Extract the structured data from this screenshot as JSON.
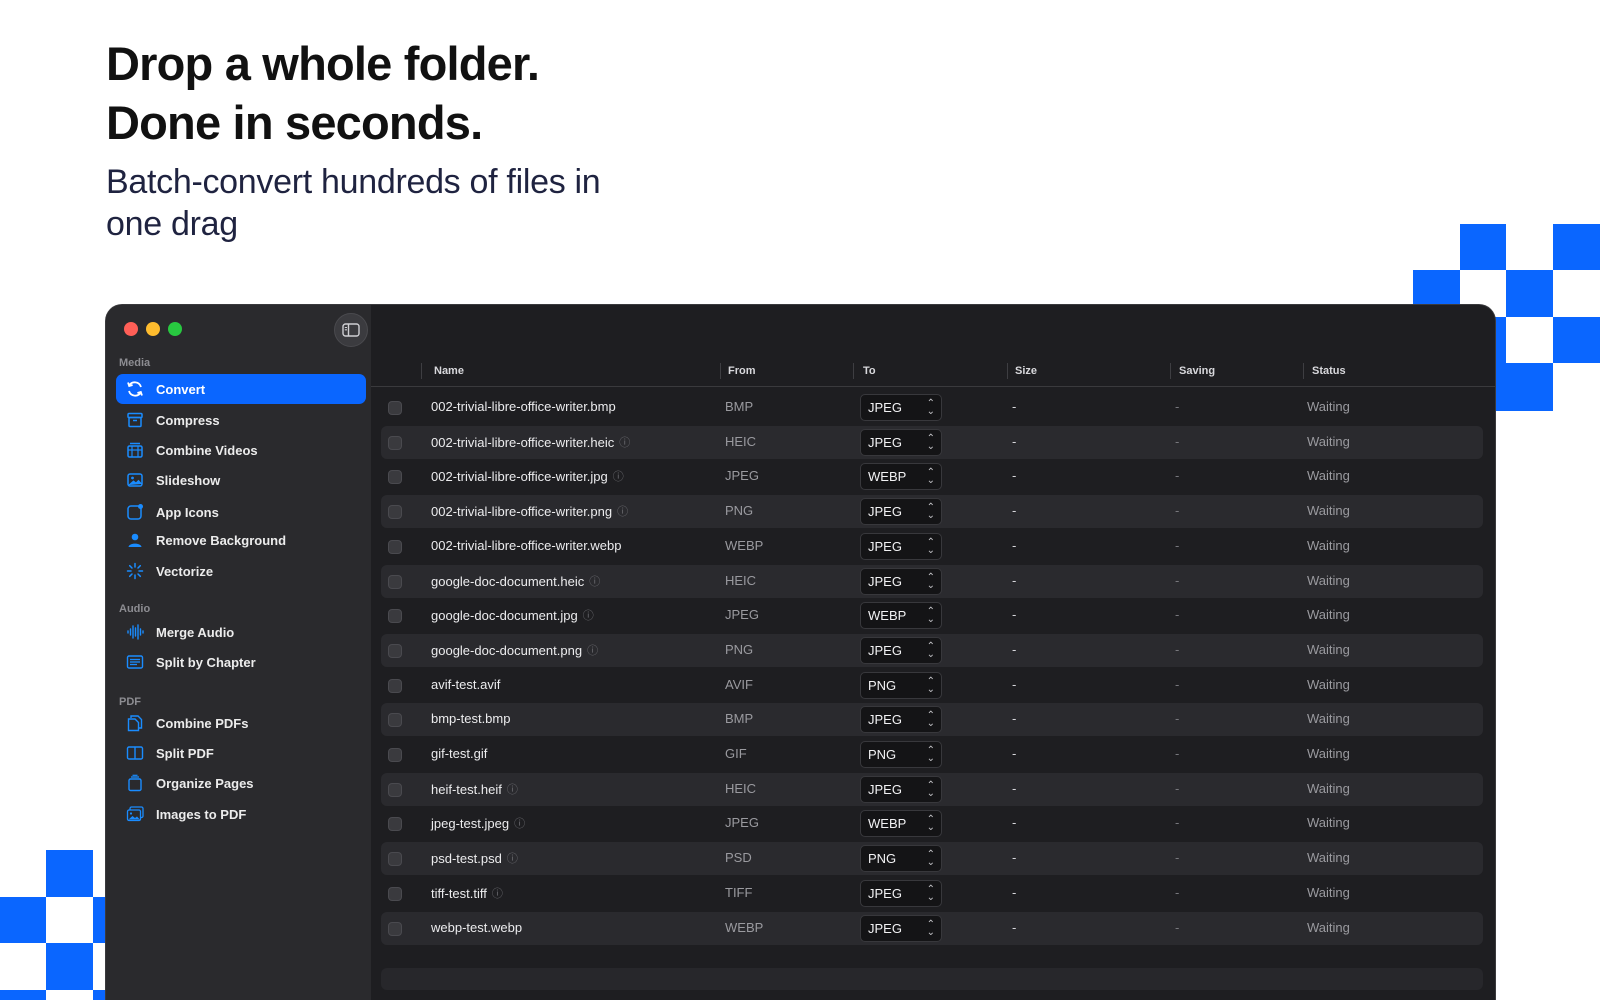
{
  "hero": {
    "title_line1": "Drop a whole folder.",
    "title_line2": "Done in seconds.",
    "subtitle_line1": "Batch-convert hundreds of files in",
    "subtitle_line2": "one drag"
  },
  "colors": {
    "accent": "#0a66ff",
    "window_bg": "#1e1e21",
    "sidebar_bg": "#2a2a2d",
    "close": "#ff5f57",
    "minimize": "#febc2e",
    "zoom": "#28c840"
  },
  "sidebar": {
    "sections": [
      {
        "label": "Media",
        "items": [
          {
            "label": "Convert",
            "icon": "refresh-icon",
            "active": true
          },
          {
            "label": "Compress",
            "icon": "archive-box-icon"
          },
          {
            "label": "Combine Videos",
            "icon": "film-stack-icon"
          },
          {
            "label": "Slideshow",
            "icon": "photo-icon"
          },
          {
            "label": "App Icons",
            "icon": "app-badge-icon"
          },
          {
            "label": "Remove Background",
            "icon": "person-icon"
          },
          {
            "label": "Vectorize",
            "icon": "sparkle-icon"
          }
        ]
      },
      {
        "label": "Audio",
        "items": [
          {
            "label": "Merge Audio",
            "icon": "waveform-icon"
          },
          {
            "label": "Split by Chapter",
            "icon": "list-icon"
          }
        ]
      },
      {
        "label": "PDF",
        "items": [
          {
            "label": "Combine PDFs",
            "icon": "documents-icon"
          },
          {
            "label": "Split PDF",
            "icon": "split-page-icon"
          },
          {
            "label": "Organize Pages",
            "icon": "page-stack-icon"
          },
          {
            "label": "Images to PDF",
            "icon": "photos-icon"
          }
        ]
      }
    ]
  },
  "table": {
    "columns": [
      "Name",
      "From",
      "To",
      "Size",
      "Saving",
      "Status"
    ],
    "rows": [
      {
        "name": "002-trivial-libre-office-writer.bmp",
        "info": false,
        "from": "BMP",
        "to": "JPEG",
        "size": "-",
        "saving": "-",
        "status": "Waiting"
      },
      {
        "name": "002-trivial-libre-office-writer.heic",
        "info": true,
        "from": "HEIC",
        "to": "JPEG",
        "size": "-",
        "saving": "-",
        "status": "Waiting"
      },
      {
        "name": "002-trivial-libre-office-writer.jpg",
        "info": true,
        "from": "JPEG",
        "to": "WEBP",
        "size": "-",
        "saving": "-",
        "status": "Waiting"
      },
      {
        "name": "002-trivial-libre-office-writer.png",
        "info": true,
        "from": "PNG",
        "to": "JPEG",
        "size": "-",
        "saving": "-",
        "status": "Waiting"
      },
      {
        "name": "002-trivial-libre-office-writer.webp",
        "info": false,
        "from": "WEBP",
        "to": "JPEG",
        "size": "-",
        "saving": "-",
        "status": "Waiting"
      },
      {
        "name": "google-doc-document.heic",
        "info": true,
        "from": "HEIC",
        "to": "JPEG",
        "size": "-",
        "saving": "-",
        "status": "Waiting"
      },
      {
        "name": "google-doc-document.jpg",
        "info": true,
        "from": "JPEG",
        "to": "WEBP",
        "size": "-",
        "saving": "-",
        "status": "Waiting"
      },
      {
        "name": "google-doc-document.png",
        "info": true,
        "from": "PNG",
        "to": "JPEG",
        "size": "-",
        "saving": "-",
        "status": "Waiting"
      },
      {
        "name": "avif-test.avif",
        "info": false,
        "from": "AVIF",
        "to": "PNG",
        "size": "-",
        "saving": "-",
        "status": "Waiting"
      },
      {
        "name": "bmp-test.bmp",
        "info": false,
        "from": "BMP",
        "to": "JPEG",
        "size": "-",
        "saving": "-",
        "status": "Waiting"
      },
      {
        "name": "gif-test.gif",
        "info": false,
        "from": "GIF",
        "to": "PNG",
        "size": "-",
        "saving": "-",
        "status": "Waiting"
      },
      {
        "name": "heif-test.heif",
        "info": true,
        "from": "HEIC",
        "to": "JPEG",
        "size": "-",
        "saving": "-",
        "status": "Waiting"
      },
      {
        "name": "jpeg-test.jpeg",
        "info": true,
        "from": "JPEG",
        "to": "WEBP",
        "size": "-",
        "saving": "-",
        "status": "Waiting"
      },
      {
        "name": "psd-test.psd",
        "info": true,
        "from": "PSD",
        "to": "PNG",
        "size": "-",
        "saving": "-",
        "status": "Waiting"
      },
      {
        "name": "tiff-test.tiff",
        "info": true,
        "from": "TIFF",
        "to": "JPEG",
        "size": "-",
        "saving": "-",
        "status": "Waiting"
      },
      {
        "name": "webp-test.webp",
        "info": false,
        "from": "WEBP",
        "to": "JPEG",
        "size": "-",
        "saving": "-",
        "status": "Waiting"
      }
    ]
  }
}
